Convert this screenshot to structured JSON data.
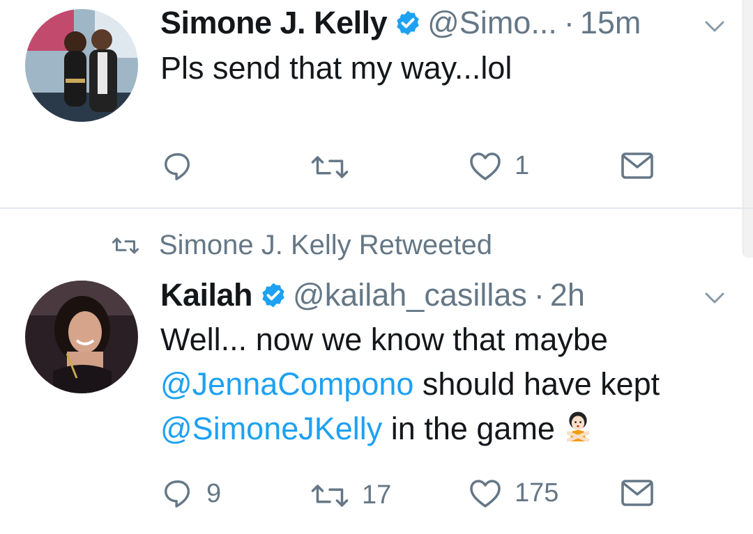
{
  "tweets": [
    {
      "name": "Simone J. Kelly",
      "handle": "@Simo...",
      "dot": "·",
      "time": "15m",
      "text": "Pls send that my way...lol",
      "reply_count": "",
      "retweet_count": "",
      "like_count": "1"
    },
    {
      "retweeted_by": "Simone J. Kelly Retweeted",
      "name": "Kailah",
      "handle": "@kailah_casillas",
      "dot": "·",
      "time": "2h",
      "text_part1": "Well... now we know that maybe",
      "mention1": "@JennaCompono",
      "text_part2": " should have kept",
      "mention2": "@SimoneJKelly",
      "text_part3": " in the game",
      "reply_count": "9",
      "retweet_count": "17",
      "like_count": "175"
    }
  ],
  "colors": {
    "accent": "#1da1f2",
    "secondary_text": "#657786",
    "divider": "#e1e8ed"
  },
  "icons": [
    "verified-badge-icon",
    "chevron-down-icon",
    "reply-icon",
    "retweet-icon",
    "like-icon",
    "direct-message-icon",
    "person-gesturing-no-emoji"
  ]
}
